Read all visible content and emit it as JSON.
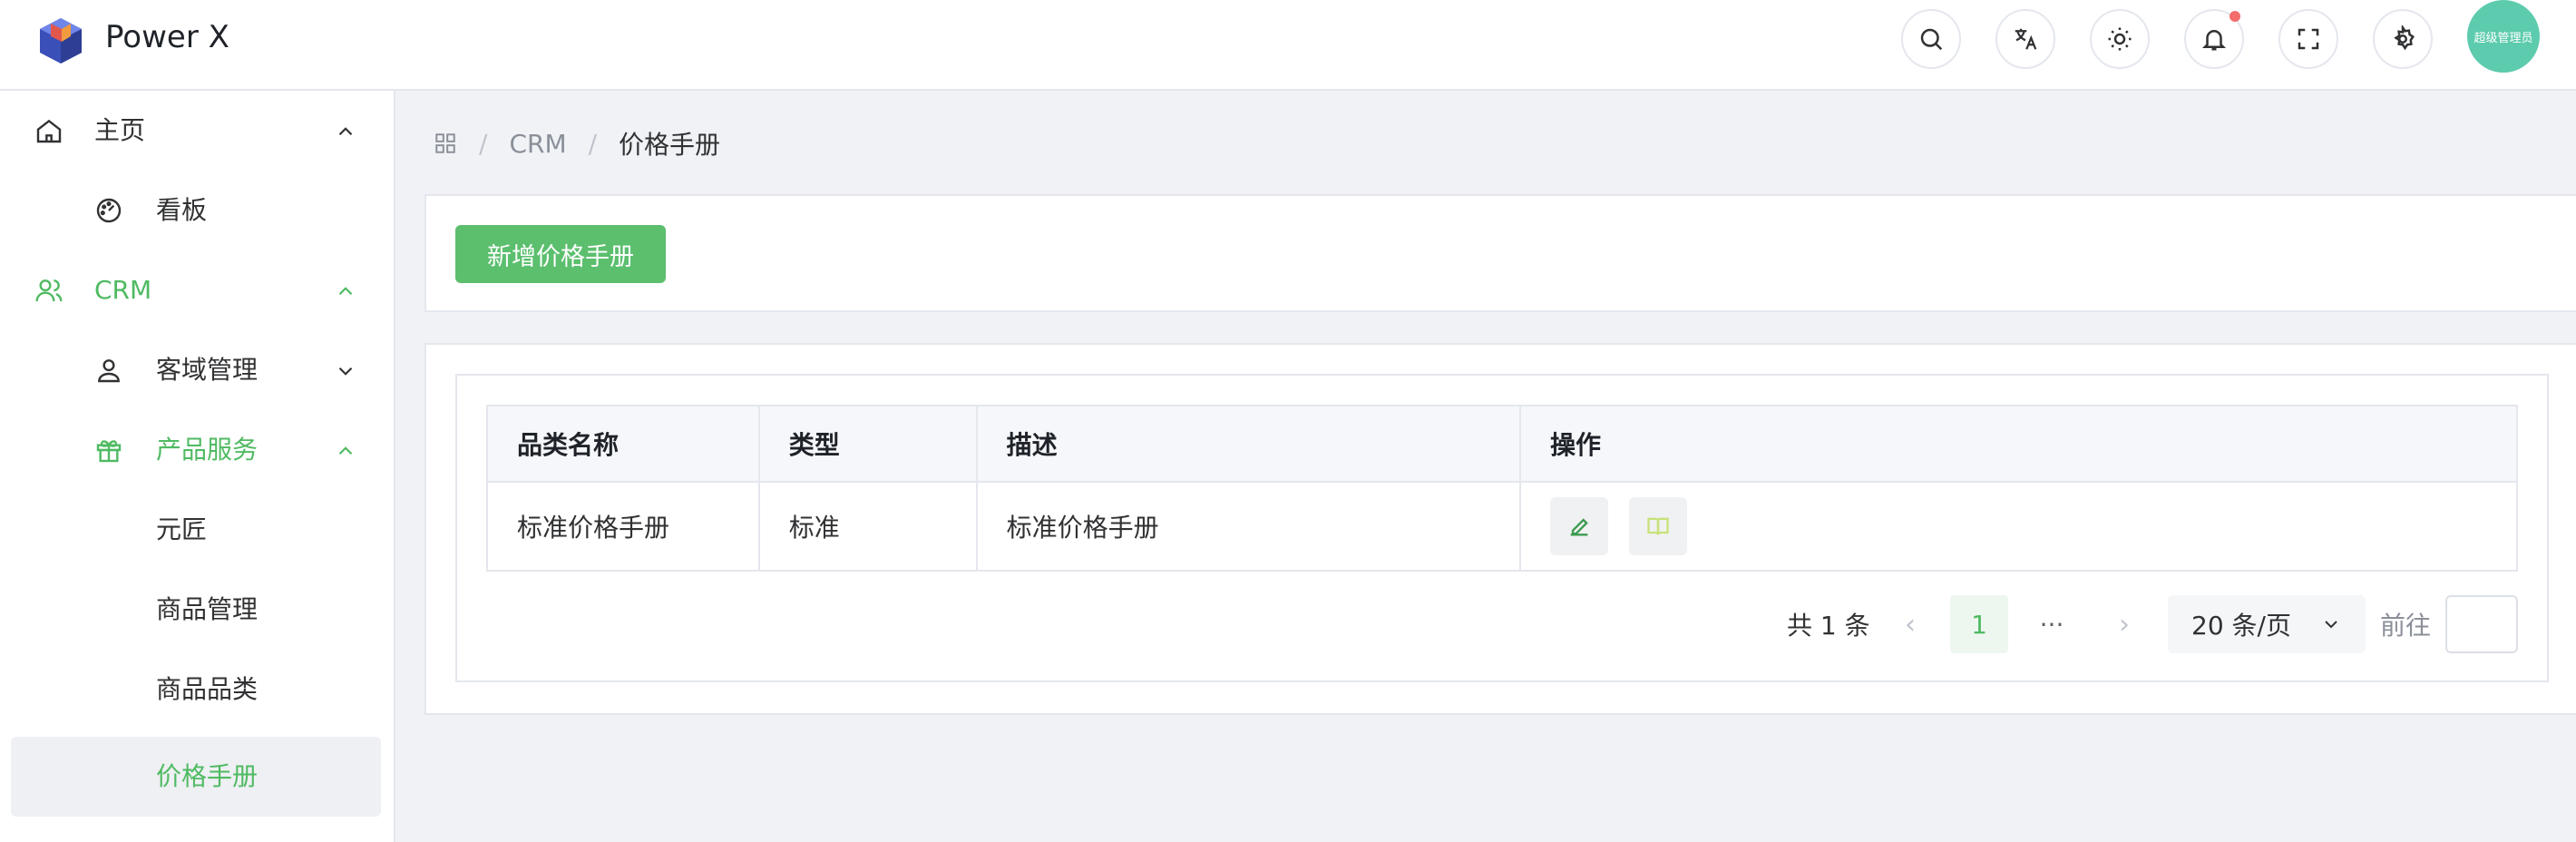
{
  "app": {
    "title": "Power X"
  },
  "header": {
    "icons": [
      "search-icon",
      "translate-icon",
      "theme-icon",
      "bell-icon",
      "fullscreen-icon",
      "settings-icon"
    ],
    "avatar_text": "超级管理员",
    "notify_color": "#f56c6c"
  },
  "sidebar": {
    "items": [
      {
        "label": "主页",
        "icon": "home-icon",
        "chevron": "up"
      },
      {
        "label": "看板",
        "icon": "dashboard-icon"
      },
      {
        "label": "CRM",
        "icon": "users-icon",
        "chevron": "up",
        "active": true
      },
      {
        "label": "客域管理",
        "icon": "user-icon",
        "chevron": "down"
      },
      {
        "label": "产品服务",
        "icon": "gift-icon",
        "chevron": "up",
        "active": true
      },
      {
        "label": "元匠"
      },
      {
        "label": "商品管理"
      },
      {
        "label": "商品品类"
      },
      {
        "label": "价格手册",
        "active": true,
        "selected": true
      }
    ]
  },
  "breadcrumb": {
    "items": [
      "CRM",
      "价格手册"
    ],
    "separator": "/"
  },
  "toolbar": {
    "add_label": "新增价格手册"
  },
  "table": {
    "headers": [
      "品类名称",
      "类型",
      "描述",
      "操作"
    ],
    "rows": [
      {
        "name": "标准价格手册",
        "type": "标准",
        "desc": "标准价格手册"
      }
    ]
  },
  "pagination": {
    "total_text": "共 1 条",
    "current_page": "1",
    "more": "···",
    "page_size": "20 条/页",
    "goto_label": "前往"
  },
  "colors": {
    "accent": "#4fba62",
    "primary_button": "#5bbf6e",
    "avatar": "#5dcbad"
  }
}
